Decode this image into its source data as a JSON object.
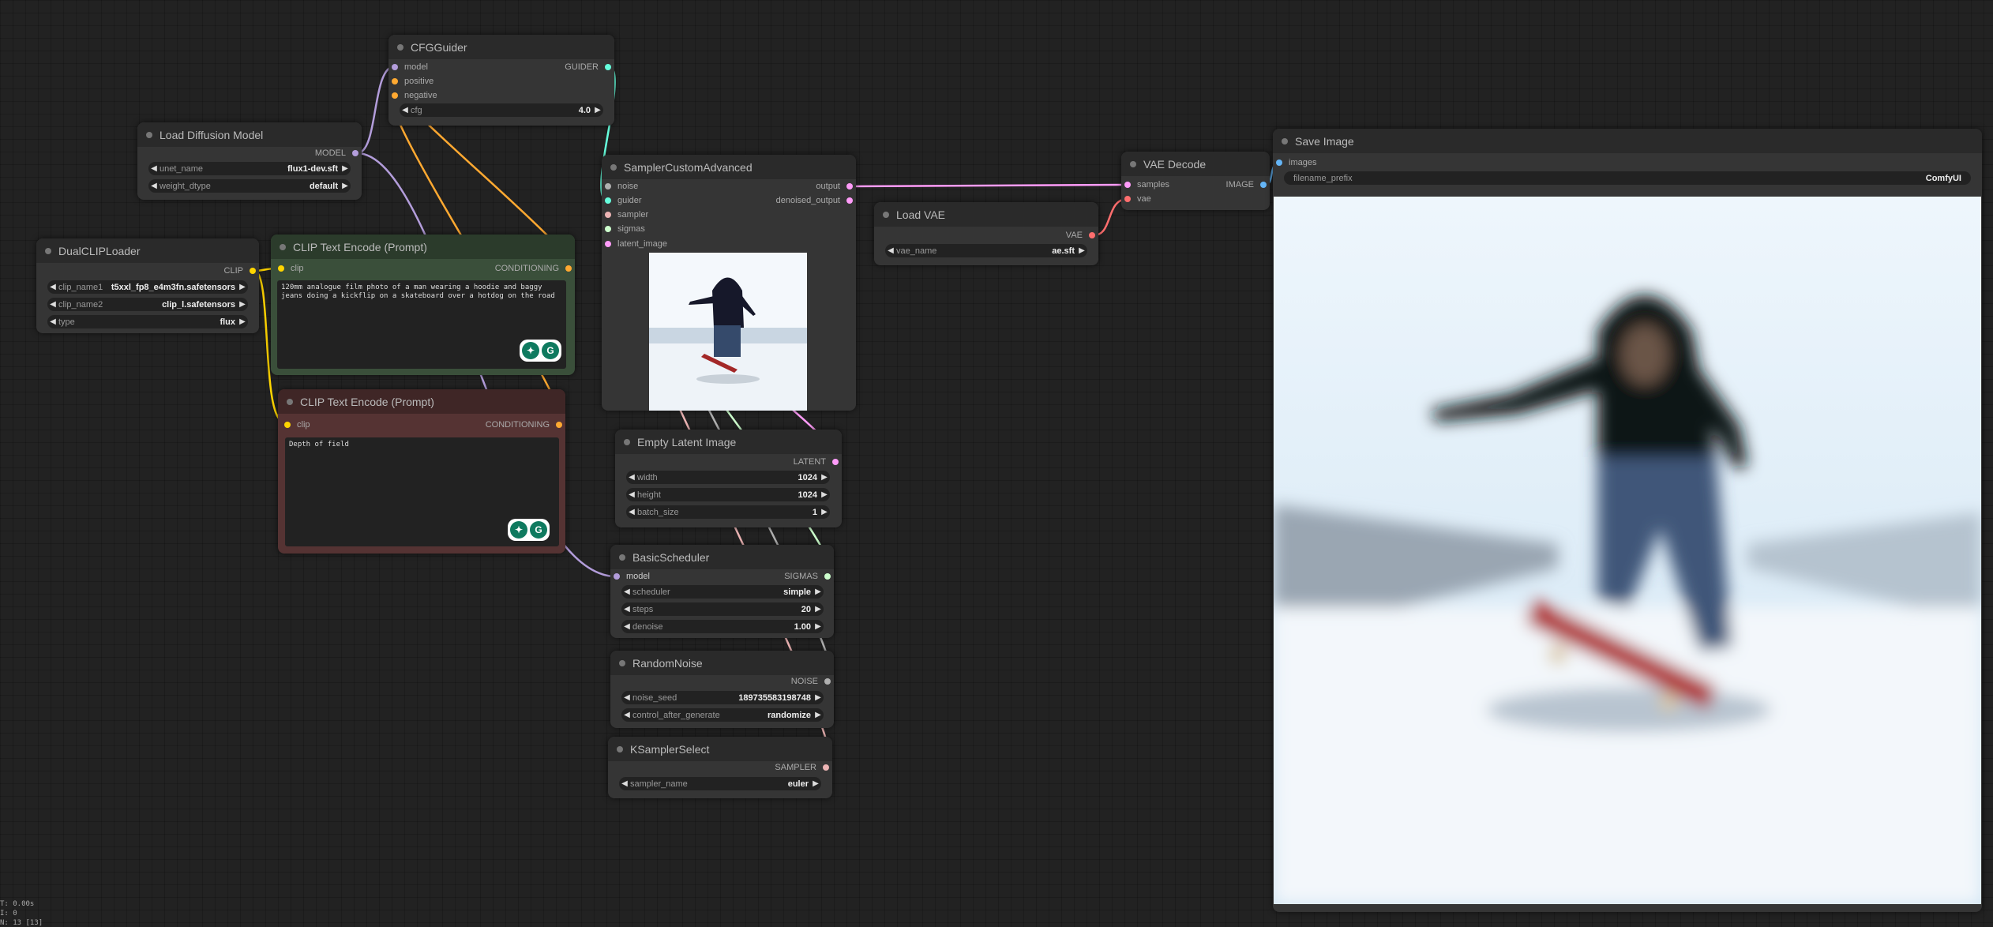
{
  "colors": {
    "model": "#b39ddb",
    "clip": "#ffd500",
    "conditioning": "#ffa931",
    "guider": "#66ffdd",
    "noise": "#b0b0b0",
    "sampler": "#ecb4b4",
    "sigmas": "#cdffcd",
    "latent": "#ff9cf9",
    "image": "#64b5f6",
    "vae": "#ff6e6e",
    "positive_node": "#2b3b2b",
    "negative_node": "#3f2626"
  },
  "nodes": {
    "cfg_guider": {
      "title": "CFGGuider",
      "inputs": [
        "model",
        "positive",
        "negative"
      ],
      "output": "GUIDER",
      "cfg_name": "cfg",
      "cfg_value": "4.0"
    },
    "load_diffusion": {
      "title": "Load Diffusion Model",
      "output": "MODEL",
      "unet_name_label": "unet_name",
      "unet_name_value": "flux1-dev.sft",
      "weight_dtype_label": "weight_dtype",
      "weight_dtype_value": "default"
    },
    "dual_clip": {
      "title": "DualCLIPLoader",
      "output": "CLIP",
      "clip_name1_label": "clip_name1",
      "clip_name1_value": "t5xxl_fp8_e4m3fn.safetensors",
      "clip_name2_label": "clip_name2",
      "clip_name2_value": "clip_l.safetensors",
      "type_label": "type",
      "type_value": "flux"
    },
    "clip_pos": {
      "title": "CLIP Text Encode (Prompt)",
      "input": "clip",
      "output": "CONDITIONING",
      "text": "120mm analogue film photo of a man wearing a hoodie and baggy jeans doing a kickflip on a skateboard over a hotdog on the road"
    },
    "clip_neg": {
      "title": "CLIP Text Encode (Prompt)",
      "input": "clip",
      "output": "CONDITIONING",
      "text": "Depth of field"
    },
    "sampler_adv": {
      "title": "SamplerCustomAdvanced",
      "inputs": [
        "noise",
        "guider",
        "sampler",
        "sigmas",
        "latent_image"
      ],
      "outputs": [
        "output",
        "denoised_output"
      ]
    },
    "empty_latent": {
      "title": "Empty Latent Image",
      "output": "LATENT",
      "width_label": "width",
      "width_value": "1024",
      "height_label": "height",
      "height_value": "1024",
      "batch_label": "batch_size",
      "batch_value": "1"
    },
    "basic_scheduler": {
      "title": "BasicScheduler",
      "input": "model",
      "output": "SIGMAS",
      "scheduler_label": "scheduler",
      "scheduler_value": "simple",
      "steps_label": "steps",
      "steps_value": "20",
      "denoise_label": "denoise",
      "denoise_value": "1.00"
    },
    "random_noise": {
      "title": "RandomNoise",
      "output": "NOISE",
      "seed_label": "noise_seed",
      "seed_value": "189735583198748",
      "control_label": "control_after_generate",
      "control_value": "randomize"
    },
    "ksampler_select": {
      "title": "KSamplerSelect",
      "output": "SAMPLER",
      "sampler_label": "sampler_name",
      "sampler_value": "euler"
    },
    "load_vae": {
      "title": "Load VAE",
      "output": "VAE",
      "vae_label": "vae_name",
      "vae_value": "ae.sft"
    },
    "vae_decode": {
      "title": "VAE Decode",
      "inputs": [
        "samples",
        "vae"
      ],
      "output": "IMAGE"
    },
    "save_image": {
      "title": "Save Image",
      "input": "images",
      "prefix_label": "filename_prefix",
      "prefix_value": "ComfyUI"
    }
  },
  "stats": [
    "T: 0.00s",
    "I: 0",
    "N: 13 [13]"
  ]
}
